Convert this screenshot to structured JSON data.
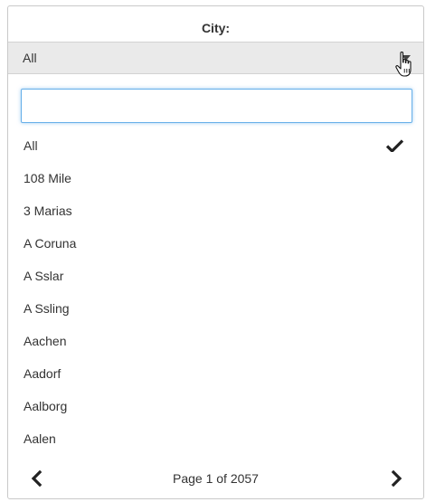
{
  "filter": {
    "title": "City:",
    "selected_value": "All",
    "search_value": "",
    "search_placeholder": ""
  },
  "options": [
    {
      "label": "All",
      "selected": true
    },
    {
      "label": "108 Mile",
      "selected": false
    },
    {
      "label": "3 Marias",
      "selected": false
    },
    {
      "label": "A Coruna",
      "selected": false
    },
    {
      "label": "A Sslar",
      "selected": false
    },
    {
      "label": "A Ssling",
      "selected": false
    },
    {
      "label": "Aachen",
      "selected": false
    },
    {
      "label": "Aadorf",
      "selected": false
    },
    {
      "label": "Aalborg",
      "selected": false
    },
    {
      "label": "Aalen",
      "selected": false
    }
  ],
  "pager": {
    "text": "Page 1 of 2057",
    "prev_icon": "chevron-left-icon",
    "next_icon": "chevron-right-icon"
  },
  "icons": {
    "dropdown": "caret-down-icon",
    "check": "checkmark-icon",
    "cursor": "hand-pointer-icon"
  },
  "colors": {
    "select_bar_bg": "#eaeaea",
    "search_focus_border": "#66afe9",
    "text": "#333333"
  }
}
